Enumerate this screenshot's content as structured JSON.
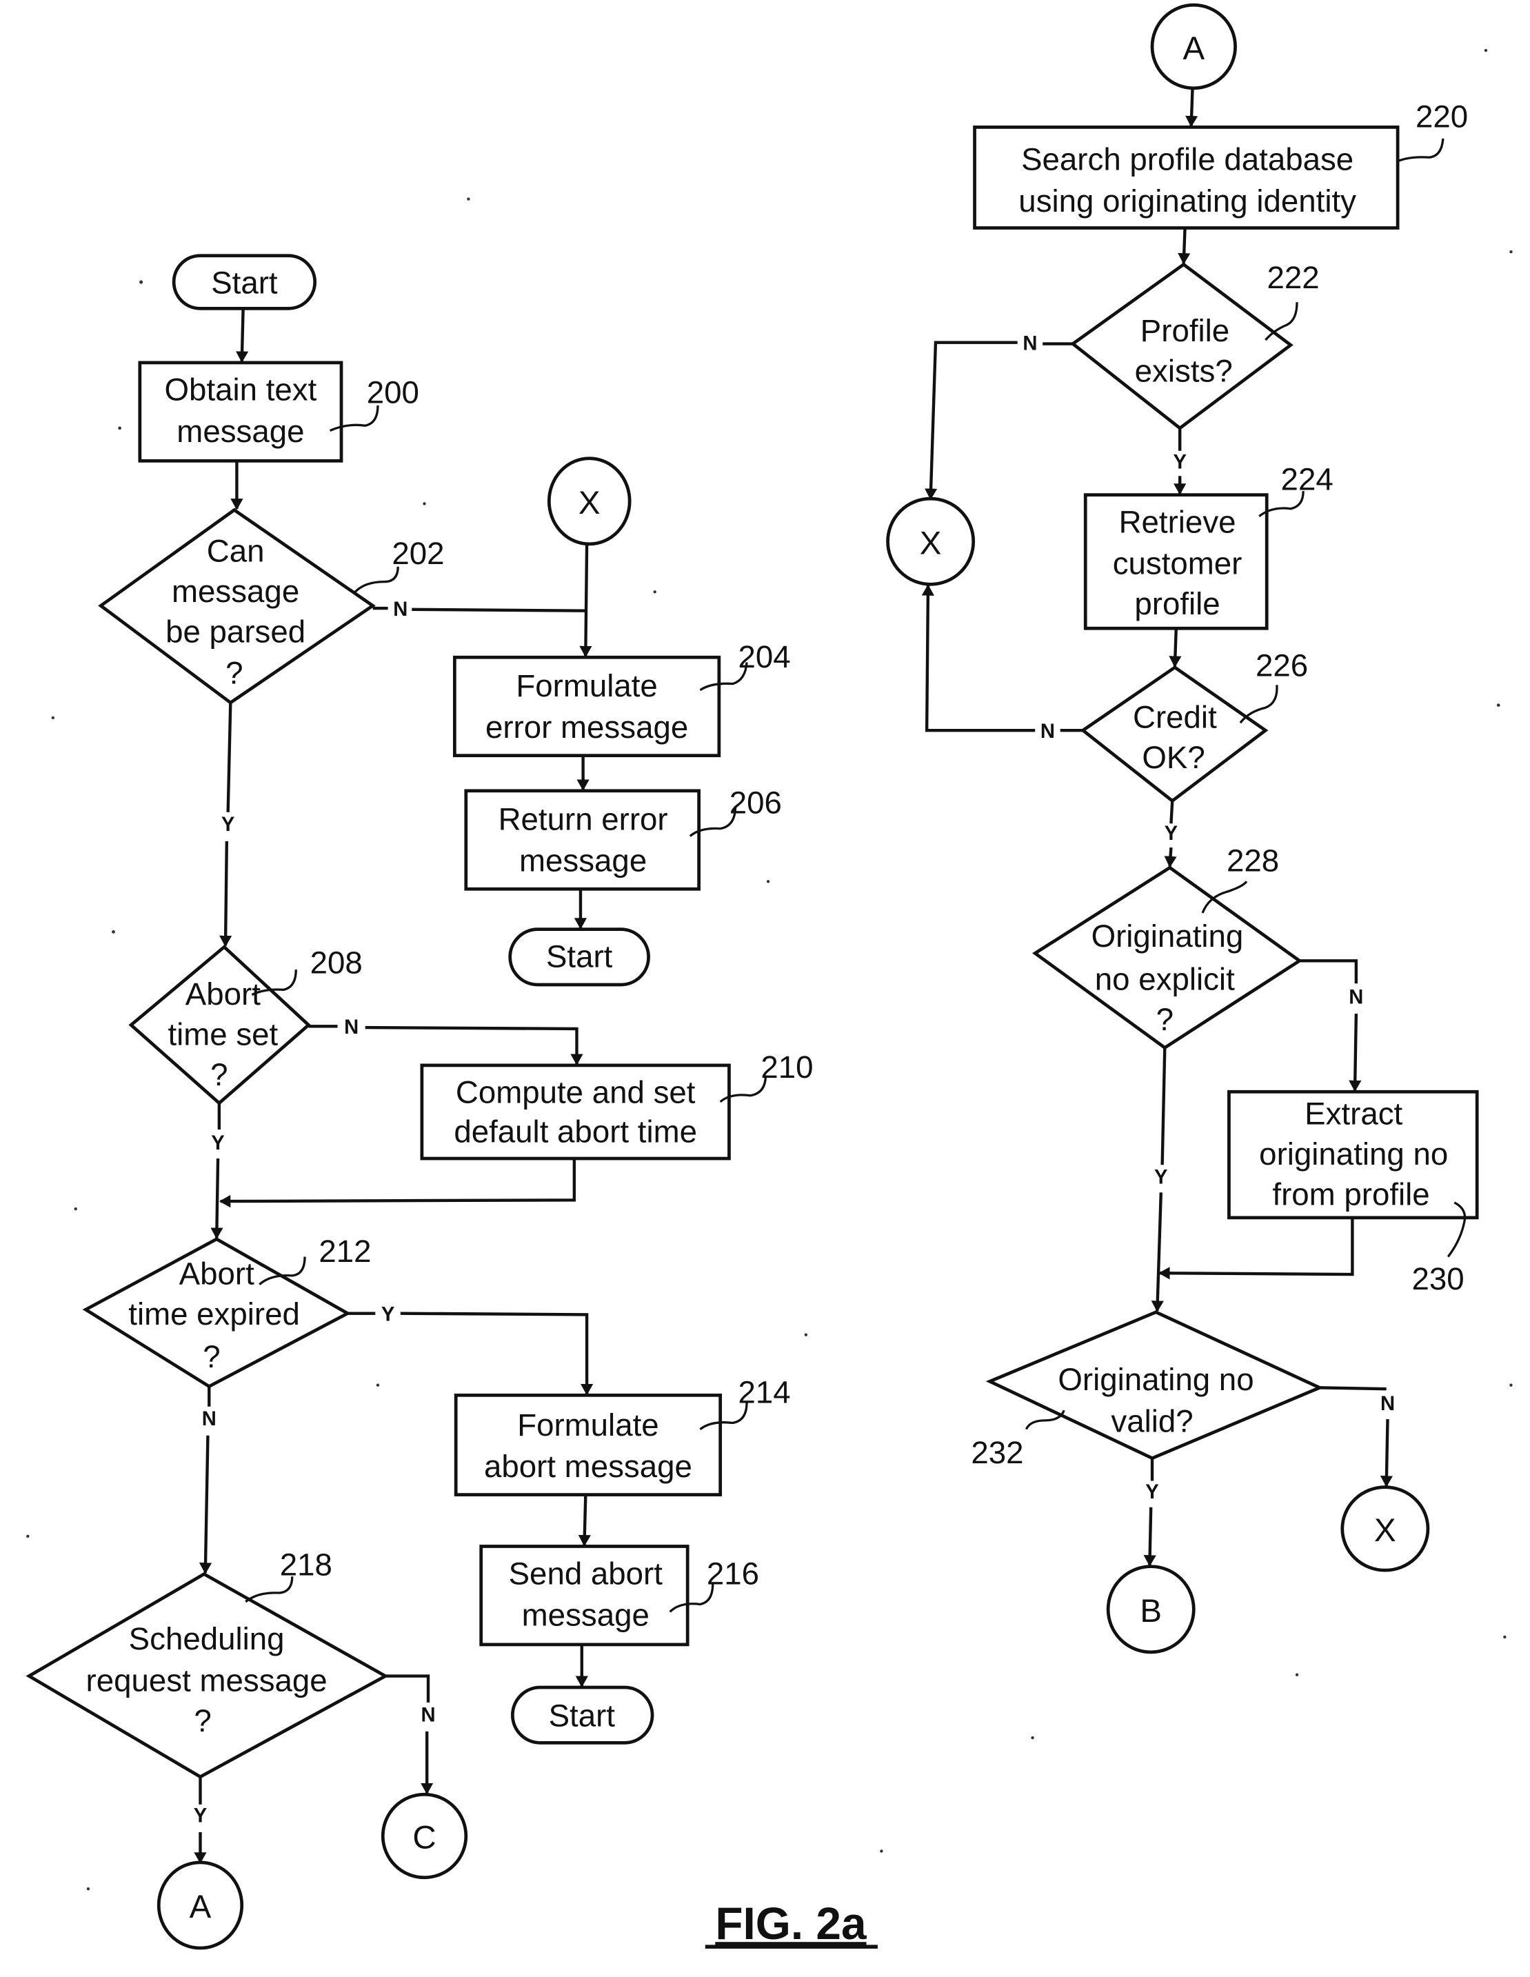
{
  "figure_title": "FIG. 2a",
  "colors": {
    "ink": "#111111",
    "paper": "#ffffff"
  },
  "left_flow": {
    "start_top": "Start",
    "step_200": {
      "ref": "200",
      "lines": [
        "Obtain text",
        "message"
      ]
    },
    "step_202": {
      "ref": "202",
      "lines": [
        "Can",
        "message",
        "be parsed",
        "?"
      ],
      "yes": "Y",
      "no": "N"
    },
    "connector_x_top": "X",
    "step_204": {
      "ref": "204",
      "lines": [
        "Formulate",
        "error message"
      ]
    },
    "step_206": {
      "ref": "206",
      "lines": [
        "Return error",
        "message"
      ]
    },
    "start_after_206": "Start",
    "step_208": {
      "ref": "208",
      "lines": [
        "Abort",
        "time set",
        "?"
      ],
      "yes": "Y",
      "no": "N"
    },
    "step_210": {
      "ref": "210",
      "lines": [
        "Compute and set",
        "default abort time"
      ]
    },
    "step_212": {
      "ref": "212",
      "lines": [
        "Abort",
        "time expired",
        "?"
      ],
      "yes": "Y",
      "no": "N"
    },
    "step_214": {
      "ref": "214",
      "lines": [
        "Formulate",
        "abort message"
      ]
    },
    "step_216": {
      "ref": "216",
      "lines": [
        "Send abort",
        "message"
      ]
    },
    "start_after_216": "Start",
    "step_218": {
      "ref": "218",
      "lines": [
        "Scheduling",
        "request message",
        "?"
      ],
      "yes": "Y",
      "no": "N"
    },
    "connector_a_bottom": "A",
    "connector_c": "C"
  },
  "right_flow": {
    "connector_a_top": "A",
    "step_220": {
      "ref": "220",
      "lines": [
        "Search profile database",
        "using  originating identity"
      ]
    },
    "step_222": {
      "ref": "222",
      "lines": [
        "Profile",
        "exists?"
      ],
      "yes": "Y",
      "no": "N"
    },
    "connector_x_mid": "X",
    "step_224": {
      "ref": "224",
      "lines": [
        "Retrieve",
        "customer",
        "profile"
      ]
    },
    "step_226": {
      "ref": "226",
      "lines": [
        "Credit",
        "OK?"
      ],
      "yes": "Y",
      "no": "N"
    },
    "step_228": {
      "ref": "228",
      "lines": [
        "Originating",
        "no explicit",
        "?"
      ],
      "yes": "Y",
      "no": "N"
    },
    "step_230": {
      "ref": "230",
      "lines": [
        "Extract",
        "originating no",
        "from profile"
      ]
    },
    "step_232": {
      "ref": "232",
      "lines": [
        "Originating no",
        "valid?"
      ],
      "yes": "Y",
      "no": "N"
    },
    "connector_b": "B",
    "connector_x_bottom": "X"
  }
}
